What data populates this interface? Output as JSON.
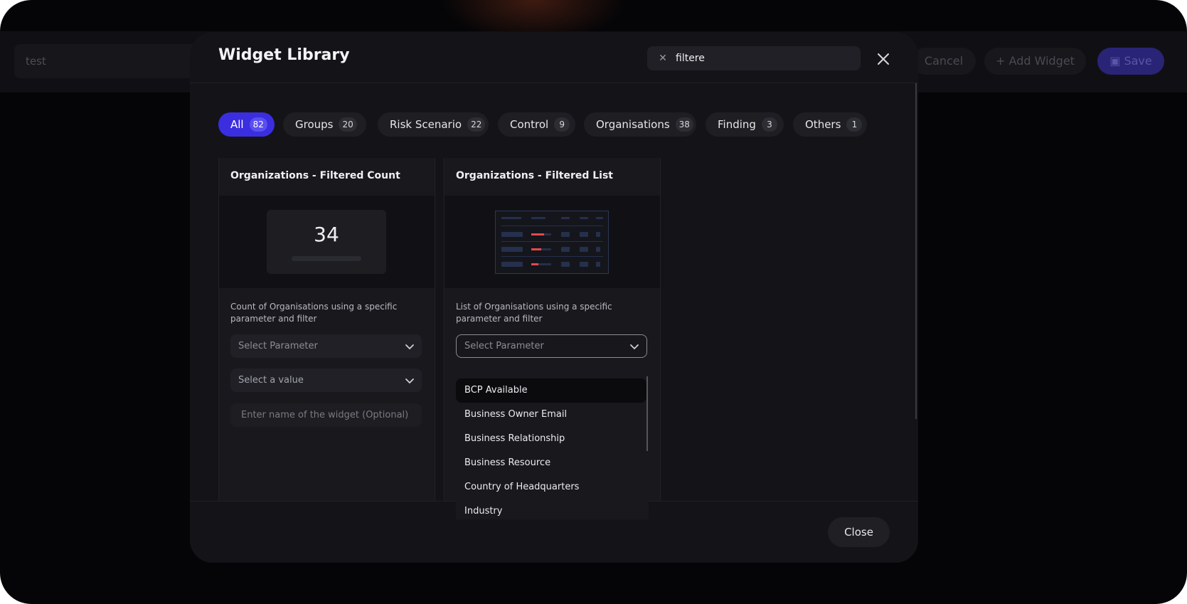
{
  "background": {
    "name_input_value": "test",
    "cancel_label": "Cancel",
    "add_widget_label": "Add Widget",
    "save_label": "Save"
  },
  "modal": {
    "title": "Widget Library",
    "search_value": "filtere",
    "close_label": "Close"
  },
  "tabs": [
    {
      "label": "All",
      "count": "82"
    },
    {
      "label": "Groups",
      "count": "20"
    },
    {
      "label": "Risk Scenario",
      "count": "22"
    },
    {
      "label": "Control",
      "count": "9"
    },
    {
      "label": "Organisations",
      "count": "38"
    },
    {
      "label": "Finding",
      "count": "3"
    },
    {
      "label": "Others",
      "count": "1"
    }
  ],
  "cards": [
    {
      "title": "Organizations - Filtered Count",
      "preview_value": "34",
      "description": "Count of Organisations using a specific parameter and filter",
      "parameter_placeholder": "Select Parameter",
      "value_placeholder": "Select a value",
      "name_placeholder": "Enter name of the widget (Optional)"
    },
    {
      "title": "Organizations - Filtered List",
      "description": "List of Organisations using a specific parameter and filter",
      "parameter_placeholder": "Select Parameter"
    }
  ],
  "dropdown_options": [
    "BCP Available",
    "Business Owner Email",
    "Business Relationship",
    "Business Resource",
    "Country of Headquarters",
    "Industry"
  ],
  "colors": {
    "accent": "#3b2ee0",
    "list_preview_highlight": "#e5484d"
  }
}
